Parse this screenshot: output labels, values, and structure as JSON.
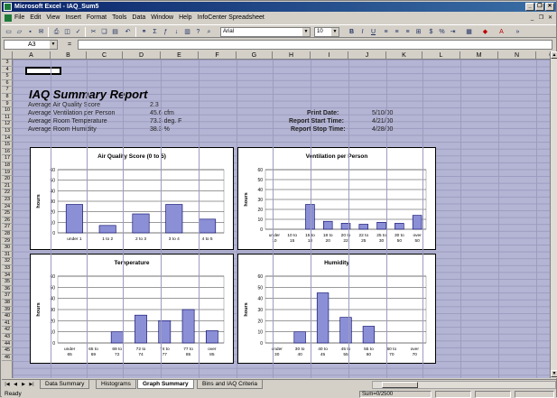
{
  "window": {
    "title": "Microsoft Excel - IAQ_Sum5"
  },
  "menubar": {
    "items": [
      "File",
      "Edit",
      "View",
      "Insert",
      "Format",
      "Tools",
      "Data",
      "Window",
      "Help",
      "InfoCenter Spreadsheet"
    ]
  },
  "toolbar": {
    "font_name": "Arial",
    "font_size": "10"
  },
  "formula_bar": {
    "name_box": "A3",
    "equals": "=",
    "content": ""
  },
  "columns": [
    "A",
    "B",
    "C",
    "D",
    "E",
    "F",
    "G",
    "H",
    "I",
    "J",
    "K",
    "L",
    "M",
    "N",
    "O"
  ],
  "rows": [
    "3",
    "4",
    "5",
    "6",
    "7",
    "8",
    "9",
    "10",
    "11",
    "12",
    "13",
    "14",
    "15",
    "16",
    "17",
    "18",
    "19",
    "20",
    "21",
    "22",
    "23",
    "24",
    "25",
    "26",
    "27",
    "28",
    "29",
    "30",
    "31",
    "32",
    "33",
    "34",
    "35",
    "36",
    "37",
    "38",
    "39",
    "40",
    "41",
    "42",
    "43",
    "44",
    "45",
    "46"
  ],
  "report": {
    "title": "IAQ Summary Report",
    "stats": [
      {
        "label": "Average Air Quality Score",
        "value": "2.3"
      },
      {
        "label": "Average Ventilation per Person",
        "value": "45.6 cfm"
      },
      {
        "label": "Average Room Temperature",
        "value": "73.3 deg. F"
      },
      {
        "label": "Average Room Humidity",
        "value": "38.3 %"
      }
    ],
    "meta": [
      {
        "label": "Print Date:",
        "value": "5/10/00"
      },
      {
        "label": "Report Start Time:",
        "value": "4/21/00"
      },
      {
        "label": "Report Stop Time:",
        "value": "4/28/00"
      }
    ]
  },
  "colors": {
    "bar_fill": "#8b8fd6",
    "bar_stroke": "#000066",
    "sheet_bg": "#b4b4d4",
    "title_bar": "#0a246a"
  },
  "chart_data": [
    {
      "type": "bar",
      "title": "Air Quality Score (0 to 5)",
      "ylabel": "hours",
      "ylim": [
        0,
        60
      ],
      "yticks": [
        0,
        10,
        20,
        30,
        40,
        50,
        60
      ],
      "categories": [
        "under 1",
        "1 to 2",
        "2 to 3",
        "3 to 4",
        "4 to 5"
      ],
      "values": [
        27,
        7,
        18,
        27,
        13
      ]
    },
    {
      "type": "bar",
      "title": "Ventilation per Person",
      "ylabel": "hours",
      "ylim": [
        0,
        60
      ],
      "yticks": [
        0,
        10,
        20,
        30,
        40,
        50,
        60
      ],
      "categories": [
        "under 10",
        "10 to 15",
        "15 to 18",
        "18 to 20",
        "20 to 22",
        "22 to 25",
        "25 to 30",
        "30 to 50",
        "over 50"
      ],
      "values": [
        0,
        0,
        25,
        8,
        6,
        5,
        7,
        6,
        14
      ]
    },
    {
      "type": "bar",
      "title": "Temperature",
      "ylabel": "hours",
      "ylim": [
        0,
        60
      ],
      "yticks": [
        0,
        10,
        20,
        30,
        40,
        50,
        60
      ],
      "categories": [
        "under 65",
        "65 to 69",
        "69 to 72",
        "72 to 74",
        "74 to 77",
        "77 to 85",
        "over 85"
      ],
      "values": [
        0,
        0,
        10,
        25,
        20,
        30,
        11
      ]
    },
    {
      "type": "bar",
      "title": "Humidity",
      "ylabel": "hours",
      "ylim": [
        0,
        60
      ],
      "yticks": [
        0,
        10,
        20,
        30,
        40,
        50,
        60
      ],
      "categories": [
        "under 30",
        "30 to 40",
        "40 to 45",
        "45 to 55",
        "55 to 60",
        "60 to 70",
        "over 70"
      ],
      "values": [
        0,
        10,
        45,
        23,
        15,
        0,
        0
      ]
    }
  ],
  "sheet_tabs": [
    "Data Summary",
    "Histograms",
    "Graph Summary",
    "Bins and IAQ Criteria"
  ],
  "active_tab": "Graph Summary",
  "status": {
    "text": "Ready",
    "sum": "Sum=0/2500"
  }
}
